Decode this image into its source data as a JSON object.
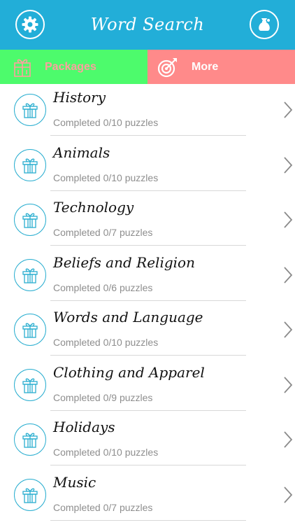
{
  "header": {
    "title": "Word Search",
    "settings_icon": "gear-icon",
    "store_icon": "coin-bag-icon",
    "color": "#22aed8"
  },
  "tabs": [
    {
      "label": "Packages",
      "icon": "packages-icon",
      "color": "#4dfb6c",
      "label_color": "#ff9f9f"
    },
    {
      "label": "More",
      "icon": "target-icon",
      "color": "#ff8a8a",
      "label_color": "#ffffff"
    }
  ],
  "packages": [
    {
      "title": "History",
      "status": "Completed 0/10 puzzles"
    },
    {
      "title": "Animals",
      "status": "Completed 0/10 puzzles"
    },
    {
      "title": "Technology",
      "status": "Completed 0/7 puzzles"
    },
    {
      "title": "Beliefs and Religion",
      "status": "Completed 0/6 puzzles"
    },
    {
      "title": "Words and Language",
      "status": "Completed 0/10 puzzles"
    },
    {
      "title": "Clothing and Apparel",
      "status": "Completed 0/9 puzzles"
    },
    {
      "title": "Holidays",
      "status": "Completed 0/10 puzzles"
    },
    {
      "title": "Music",
      "status": "Completed 0/7 puzzles"
    }
  ],
  "row_icon": "gift-icon",
  "row_chevron": "chevron-right-icon"
}
